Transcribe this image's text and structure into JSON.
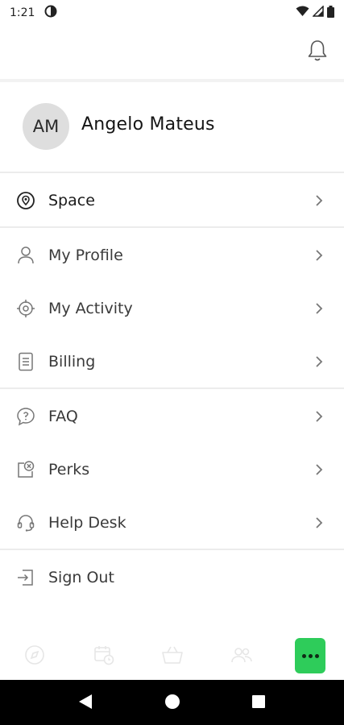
{
  "status_bar": {
    "time": "1:21"
  },
  "profile": {
    "initials": "AM",
    "name": "Angelo Mateus"
  },
  "menu": {
    "space": "Space",
    "my_profile": "My Profile",
    "my_activity": "My Activity",
    "billing": "Billing",
    "faq": "FAQ",
    "perks": "Perks",
    "help_desk": "Help Desk",
    "sign_out": "Sign Out"
  },
  "tabbar": {
    "icons": [
      "compass-icon",
      "calendar-clock-icon",
      "basket-icon",
      "people-icon",
      "more-icon"
    ],
    "active_color": "#2ecc5a"
  }
}
